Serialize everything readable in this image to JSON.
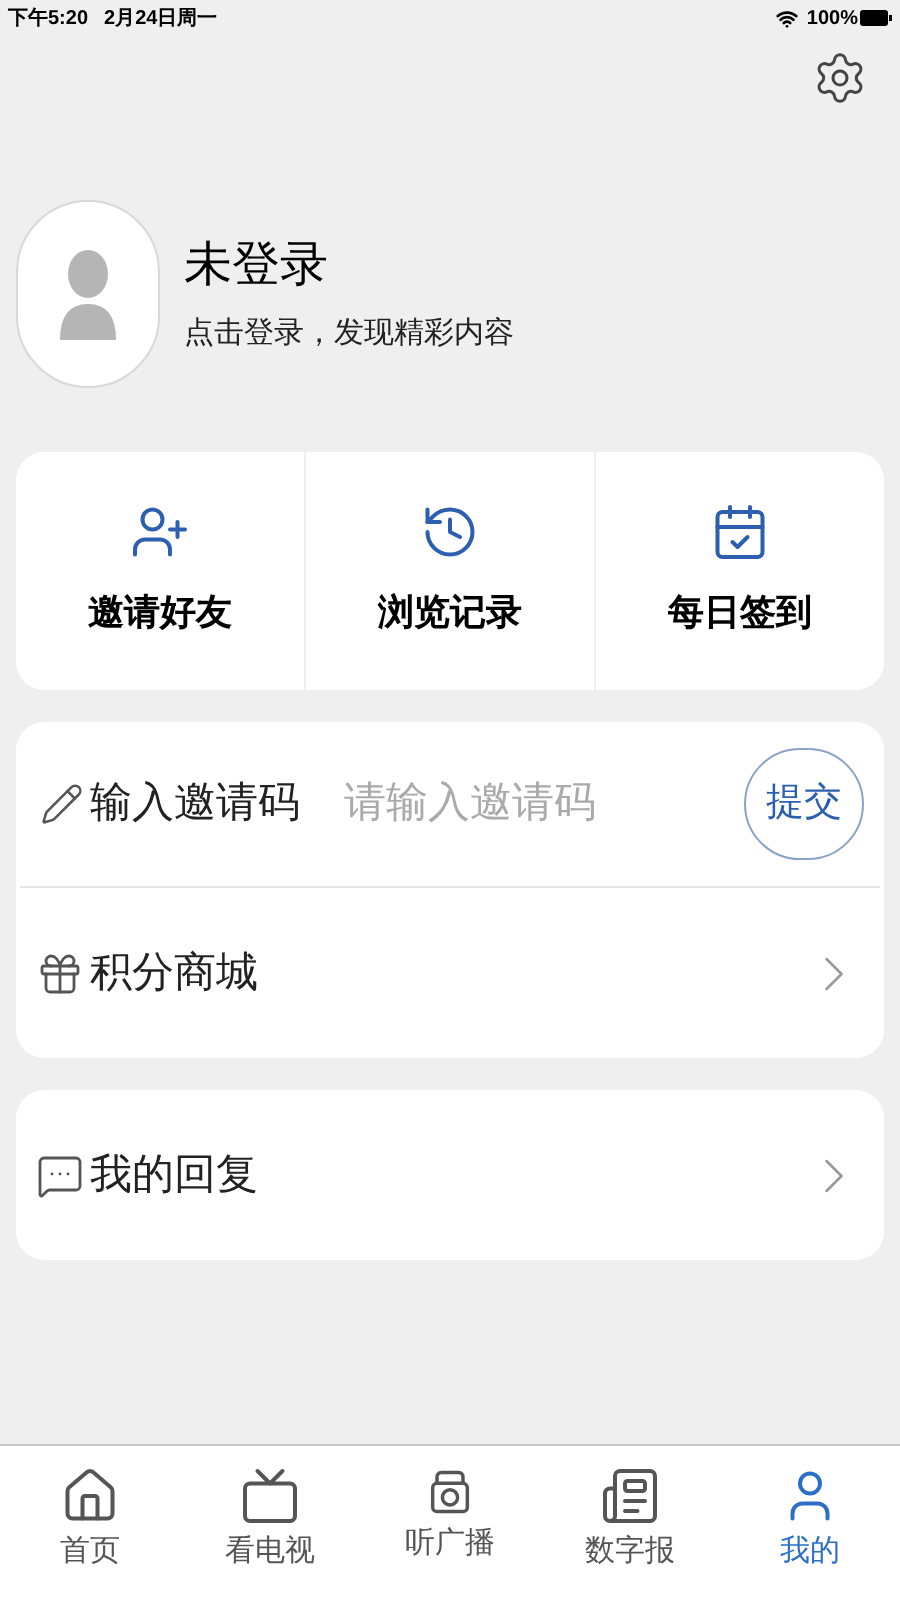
{
  "status_bar": {
    "time": "下午5:20",
    "date": "2月24日周一",
    "battery": "100%"
  },
  "profile": {
    "name": "未登录",
    "subtitle": "点击登录，发现精彩内容"
  },
  "quick_actions": [
    {
      "kind": "invite",
      "label": "邀请好友"
    },
    {
      "kind": "history",
      "label": "浏览记录"
    },
    {
      "kind": "checkin",
      "label": "每日签到"
    }
  ],
  "invite_code": {
    "label": "输入邀请码",
    "placeholder": "请输入邀请码",
    "button": "提交"
  },
  "menu_items": [
    {
      "kind": "shop",
      "label": "积分商城"
    },
    {
      "kind": "reply",
      "label": "我的回复"
    }
  ],
  "tabs": [
    {
      "kind": "home",
      "label": "首页",
      "selected": false
    },
    {
      "kind": "tv",
      "label": "看电视",
      "selected": false
    },
    {
      "kind": "radio",
      "label": "听广播",
      "selected": false
    },
    {
      "kind": "paper",
      "label": "数字报",
      "selected": false
    },
    {
      "kind": "me",
      "label": "我的",
      "selected": true
    }
  ]
}
